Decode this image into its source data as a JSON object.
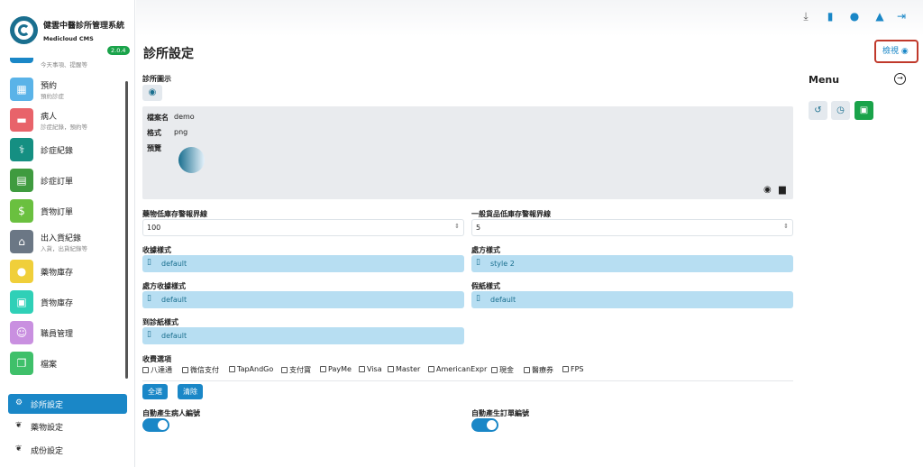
{
  "brand": {
    "title": "健雲中醫診所管理系統",
    "subtitle": "Medicloud CMS",
    "version": "2.0.4"
  },
  "sidebar": {
    "partial_item_sub": "今天事項、提醒等",
    "items": [
      {
        "label": "預約",
        "sub": "預約診症",
        "color": "#5ab3e8",
        "icon": "calendar-icon"
      },
      {
        "label": "病人",
        "sub": "診症紀錄，預約等",
        "color": "#e8636a",
        "icon": "bed-icon"
      },
      {
        "label": "診症紀錄",
        "sub": "",
        "color": "#158f82",
        "icon": "stethoscope-icon"
      },
      {
        "label": "診症訂單",
        "sub": "",
        "color": "#3f9b3f",
        "icon": "document-icon"
      },
      {
        "label": "貨物訂單",
        "sub": "",
        "color": "#6ac03f",
        "icon": "invoice-icon"
      },
      {
        "label": "出入貨紀錄",
        "sub": "入貨，出貨紀錄等",
        "color": "#6b7785",
        "icon": "warehouse-icon"
      },
      {
        "label": "藥物庫存",
        "sub": "",
        "color": "#f0cf3a",
        "icon": "pills-icon"
      },
      {
        "label": "貨物庫存",
        "sub": "",
        "color": "#2fd0b7",
        "icon": "boxes-icon"
      },
      {
        "label": "職員管理",
        "sub": "",
        "color": "#c990e0",
        "icon": "user-icon"
      },
      {
        "label": "檔案",
        "sub": "",
        "color": "#3fc06a",
        "icon": "files-icon"
      }
    ],
    "bottom": [
      {
        "label": "診所設定",
        "active": true,
        "icon": "gears-icon"
      },
      {
        "label": "藥物設定",
        "active": false,
        "icon": "leaf-icon"
      },
      {
        "label": "成份設定",
        "active": false,
        "icon": "leaf-icon"
      }
    ]
  },
  "topbar": {
    "icons": [
      "download-icon",
      "clipboard-icon",
      "user-icon",
      "bell-icon",
      "logout-icon"
    ]
  },
  "page": {
    "title": "診所設定",
    "view_label": "檢視"
  },
  "form": {
    "clinic_logo_label": "診所圖示",
    "file_name_key": "檔案名",
    "file_name_value": "demo",
    "format_key": "格式",
    "format_value": "png",
    "preview_key": "預覽",
    "med_low_stock_label": "藥物低庫存警報界線",
    "med_low_stock_value": "100",
    "goods_low_stock_label": "一般貨品低庫存警報界線",
    "goods_low_stock_value": "5",
    "receipt_style_label": "收據樣式",
    "receipt_style_value": "default",
    "prescription_style_label": "處方樣式",
    "prescription_style_value": "style 2",
    "rx_receipt_style_label": "處方收據樣式",
    "rx_receipt_style_value": "default",
    "leave_style_label": "假紙樣式",
    "leave_style_value": "default",
    "attendance_style_label": "到診紙樣式",
    "attendance_style_value": "default",
    "payment_options_label": "收費選項",
    "payment_options": [
      "八達通",
      "微信支付",
      "TapAndGo",
      "支付寶",
      "PayMe",
      "Visa",
      "Master",
      "AmericanExpr",
      "現金",
      "醫療券",
      "FPS"
    ],
    "select_all_label": "全選",
    "clear_label": "清除",
    "auto_patient_no_label": "自動產生病人編號",
    "auto_patient_no_on": true,
    "auto_order_no_label": "自動產生訂單編號",
    "auto_order_no_on": true
  },
  "menu": {
    "title": "Menu"
  }
}
